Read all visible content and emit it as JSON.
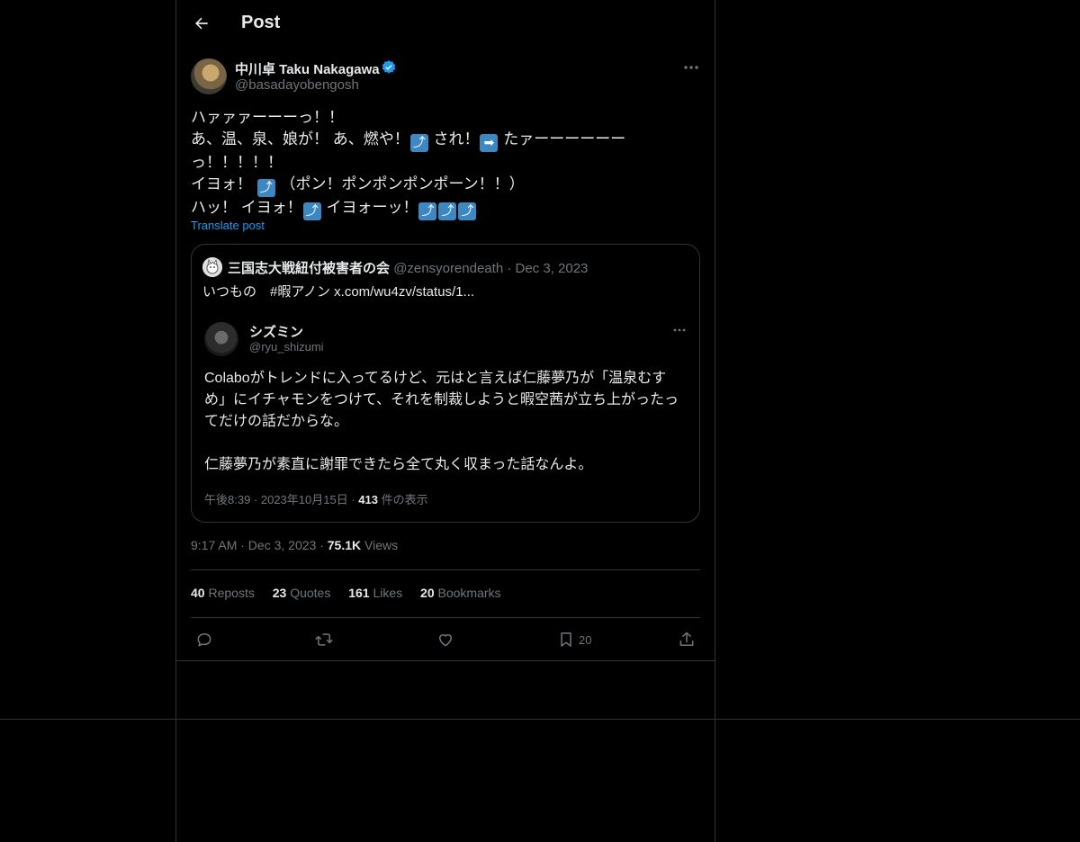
{
  "header": {
    "title": "Post"
  },
  "author": {
    "name": "中川卓 Taku Nakagawa",
    "handle": "@basadayobengosh"
  },
  "tweet": {
    "lines": [
      "ハァァァーーーっ！！",
      "あ、温、泉、娘が！ あ、燃や！",
      "され！",
      "たァーーーーーー",
      "っ！！！！！",
      "イヨォ！",
      "（ポン！ポンポンポンポーン！！）",
      "ハッ！ イヨォ！",
      "イヨォーッ！"
    ],
    "emoji": {
      "up_arrow": "⤴",
      "right_arrow": "➡"
    },
    "translate_label": "Translate post"
  },
  "quote": {
    "name": "三国志大戦紐付被害者の会",
    "meta": "@zensyorendeath · Dec 3, 2023",
    "text": "いつもの　#暇アノン  x.com/wu4zv/status/1...",
    "inner": {
      "name": "シズミン",
      "handle": "@ryu_shizumi",
      "lines": [
        "Colaboがトレンドに入ってるけど、元はと言えば仁藤夢乃が「温泉むす",
        "め」にイチャモンをつけて、それを制裁しようと暇空茜が立ち上がったっ",
        "てだけの話だからな。",
        "仁藤夢乃が素直に謝罪できたら全て丸く収まった話なんよ。"
      ],
      "meta_prefix": "午後8:39 · 2023年10月15日 · ",
      "views": "413",
      "views_label": " 件の表示"
    }
  },
  "timestamp": {
    "time": "9:17 AM · Dec 3, 2023 · ",
    "views": "75.1K",
    "views_label": " Views"
  },
  "stats": {
    "reposts": "40",
    "reposts_label": "Reposts",
    "quotes": "23",
    "quotes_label": "Quotes",
    "likes": "161",
    "likes_label": "Likes",
    "bookmarks": "20",
    "bookmarks_label": "Bookmarks"
  },
  "actions": {
    "bookmark_count": "20"
  },
  "colors": {
    "background": "#000000",
    "border": "#2f3336",
    "text": "#e7e9ea",
    "muted": "#71767b",
    "accent": "#1d9bf0",
    "emoji_blue": "#3b88c3"
  }
}
